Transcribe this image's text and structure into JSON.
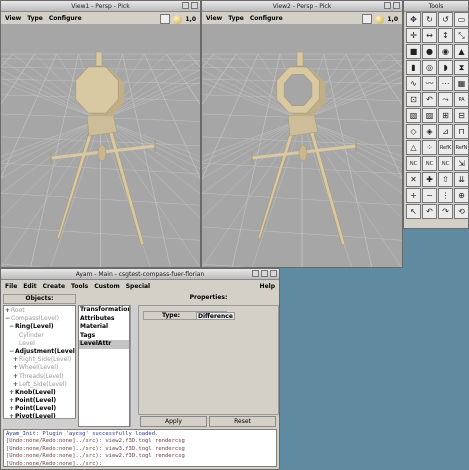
{
  "view1": {
    "title": "View1 - Persp - Pick",
    "menu": [
      "View",
      "Type",
      "Configure"
    ],
    "zoom": "1,0"
  },
  "view2": {
    "title": "View2 - Persp - Pick",
    "menu": [
      "View",
      "Type",
      "Configure"
    ],
    "zoom": "1,0"
  },
  "tools": {
    "title": "Tools",
    "icons": [
      "move-icon",
      "rotate-icon",
      "rotate-alt-icon",
      "scale-icon",
      "move-4way-icon",
      "scale-horizontal-icon",
      "scale-vertical-icon",
      "scale-uniform-icon",
      "box-icon",
      "sphere-icon",
      "disk-icon",
      "cone-icon",
      "cylinder-icon",
      "torus-icon",
      "paraboloid-icon",
      "hyperboloid-icon",
      "curve-icon",
      "spline-icon",
      "edit-points-icon",
      "lattice-icon",
      "extrude-icon",
      "revolve-icon",
      "sweep-icon",
      "skin-icon",
      "nurbs-patch-icon",
      "nurbs-patch-alt-icon",
      "gordon-icon",
      "birail-icon",
      "pm-mesh-icon",
      "pm-mesh-alt-icon",
      "bevel-icon",
      "cap-icon",
      "triangle-icon",
      "grid-dots-icon",
      "rational-icon",
      "tweak-icon",
      "nc-curve-icon",
      "nc-curve-alt-icon",
      "nc-curve-sel-icon",
      "collapse-icon",
      "knot-icon",
      "knot-alt-icon",
      "elevate-icon",
      "refine-icon",
      "insert-point-icon",
      "delete-point-icon",
      "split-icon",
      "concat-icon",
      "select-icon",
      "undo-icon",
      "redo-icon",
      "revert-icon"
    ],
    "text_labels": {
      "23": "PA",
      "34": "RefK",
      "35": "RefN",
      "36": "NC",
      "37": "NC",
      "38": "NC"
    }
  },
  "main": {
    "title": "Ayam - Main - csgtest-compass-fuer-florian",
    "menu": [
      "File",
      "Edit",
      "Create",
      "Tools",
      "Custom",
      "Special"
    ],
    "help": "Help",
    "objects_label": "Objects:",
    "properties_label": "Properties:",
    "tree": [
      {
        "label": "Root",
        "indent": 0,
        "dim": true,
        "expander": "+"
      },
      {
        "label": "Compass(Level)",
        "indent": 0,
        "dim": true,
        "expander": "-"
      },
      {
        "label": "Ring(Level)",
        "indent": 1,
        "dim": false,
        "expander": "-"
      },
      {
        "label": "Cylinder",
        "indent": 2,
        "dim": true,
        "expander": ""
      },
      {
        "label": "Level",
        "indent": 2,
        "dim": true,
        "expander": ""
      },
      {
        "label": "Adjustment(Level)",
        "indent": 1,
        "dim": false,
        "expander": "-"
      },
      {
        "label": "Right_Side(Level)",
        "indent": 2,
        "dim": true,
        "expander": "+"
      },
      {
        "label": "Wheel(Level)",
        "indent": 2,
        "dim": true,
        "expander": "+"
      },
      {
        "label": "Threads(Level)",
        "indent": 2,
        "dim": true,
        "expander": "+"
      },
      {
        "label": "Left_Side(Level)",
        "indent": 2,
        "dim": true,
        "expander": "+"
      },
      {
        "label": "Knob(Level)",
        "indent": 1,
        "dim": false,
        "expander": "+"
      },
      {
        "label": "Point(Level)",
        "indent": 1,
        "dim": false,
        "expander": "+"
      },
      {
        "label": "Point(Level)",
        "indent": 1,
        "dim": false,
        "expander": "+"
      },
      {
        "label": "Pivot(Level)",
        "indent": 1,
        "dim": false,
        "expander": "+"
      }
    ],
    "property_list": [
      "Transformations",
      "Attributes",
      "Material",
      "Tags",
      "LevelAttr"
    ],
    "selected_property": "LevelAttr",
    "type_label": "Type:",
    "type_value": "Difference",
    "apply_label": "Apply",
    "reset_label": "Reset",
    "console": [
      {
        "text": "Ayam_Init: Plugin 'aycsg' successfully loaded.",
        "info": true
      },
      {
        "text": "[Undo:none/Redo:none]../src): view2.f3D.togl rendercsg",
        "info": false
      },
      {
        "text": "[Undo:none/Redo:none]../src): view3.f3D.togl rendercsg",
        "info": false
      },
      {
        "text": "[Undo:none/Redo:none]../src): view2.f3D.togl rendercsg",
        "info": false
      },
      {
        "text": "[Undo:none/Redo:none]../src):",
        "info": false
      }
    ]
  },
  "colors": {
    "desktop": "#5f8aa0",
    "viewport_bg": "#a6a6a6",
    "model": "#d9c9a3",
    "model_shadow": "#a89a78",
    "grid": "#c3c3c3"
  }
}
